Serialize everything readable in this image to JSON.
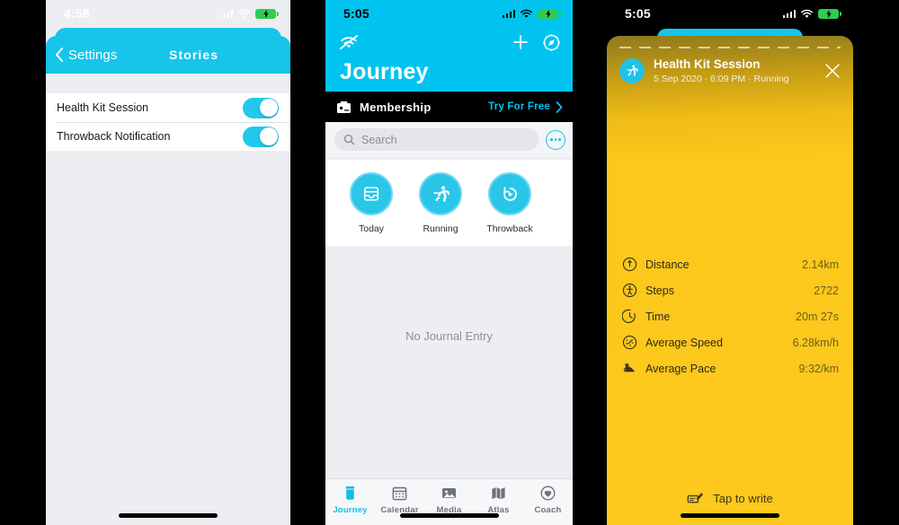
{
  "screens": {
    "left": {
      "status": {
        "time": "4:58",
        "signal_icon": "signal-bars-icon",
        "wifi_icon": "wifi-icon",
        "battery_icon": "battery-charging-icon"
      },
      "nav": {
        "back_label": "Settings",
        "back_icon": "chevron-left-icon",
        "title": "Stories"
      },
      "settings_rows": [
        {
          "label": "Health Kit Session",
          "toggle_on": true
        },
        {
          "label": "Throwback Notification",
          "toggle_on": true
        }
      ]
    },
    "middle": {
      "status": {
        "time": "5:05",
        "signal_icon": "signal-bars-icon",
        "wifi_icon": "wifi-icon",
        "battery_icon": "battery-charging-icon"
      },
      "header": {
        "title": "Journey",
        "offline_icon": "wifi-slash-icon",
        "add_icon": "plus-icon",
        "settings_icon": "gear-compass-icon"
      },
      "membership": {
        "icon": "membership-card-icon",
        "label": "Membership",
        "cta": "Try For Free",
        "cta_icon": "chevron-right-icon"
      },
      "search": {
        "placeholder": "Search",
        "icon": "search-icon",
        "more_icon": "more-dots-icon"
      },
      "categories": [
        {
          "label": "Today",
          "icon": "inbox-tray-icon"
        },
        {
          "label": "Running",
          "icon": "running-person-icon"
        },
        {
          "label": "Throwback",
          "icon": "rewind-play-icon"
        }
      ],
      "empty_state": "No Journal Entry",
      "tabs": [
        {
          "label": "Journey",
          "icon": "journey-jar-icon",
          "active": true
        },
        {
          "label": "Calendar",
          "icon": "calendar-icon",
          "active": false
        },
        {
          "label": "Media",
          "icon": "photo-icon",
          "active": false
        },
        {
          "label": "Atlas",
          "icon": "map-icon",
          "active": false
        },
        {
          "label": "Coach",
          "icon": "heart-circle-icon",
          "active": false
        }
      ]
    },
    "right": {
      "status": {
        "time": "5:05",
        "signal_icon": "signal-bars-icon",
        "wifi_icon": "wifi-icon",
        "battery_icon": "battery-charging-icon"
      },
      "card": {
        "avatar_icon": "running-person-icon",
        "title": "Health Kit Session",
        "subtitle": "5 Sep 2020 · 6:09 PM · Running",
        "close_icon": "close-x-icon"
      },
      "stats": [
        {
          "label": "Distance",
          "value": "2.14km",
          "icon": "distance-pin-icon"
        },
        {
          "label": "Steps",
          "value": "2722",
          "icon": "steps-walk-icon"
        },
        {
          "label": "Time",
          "value": "20m 27s",
          "icon": "clock-icon"
        },
        {
          "label": "Average Speed",
          "value": "6.28km/h",
          "icon": "speedometer-icon"
        },
        {
          "label": "Average Pace",
          "value": "9:32/km",
          "icon": "rabbit-pace-icon"
        }
      ],
      "footer": {
        "label": "Tap to write",
        "icon": "write-note-icon"
      }
    }
  },
  "colors": {
    "accent_cyan": "#00c4ef",
    "card_yellow": "#fdc81c",
    "card_yellow_dark": "#8f7a1d",
    "battery_green": "#2fcd4f",
    "list_bg": "#eceef2"
  }
}
